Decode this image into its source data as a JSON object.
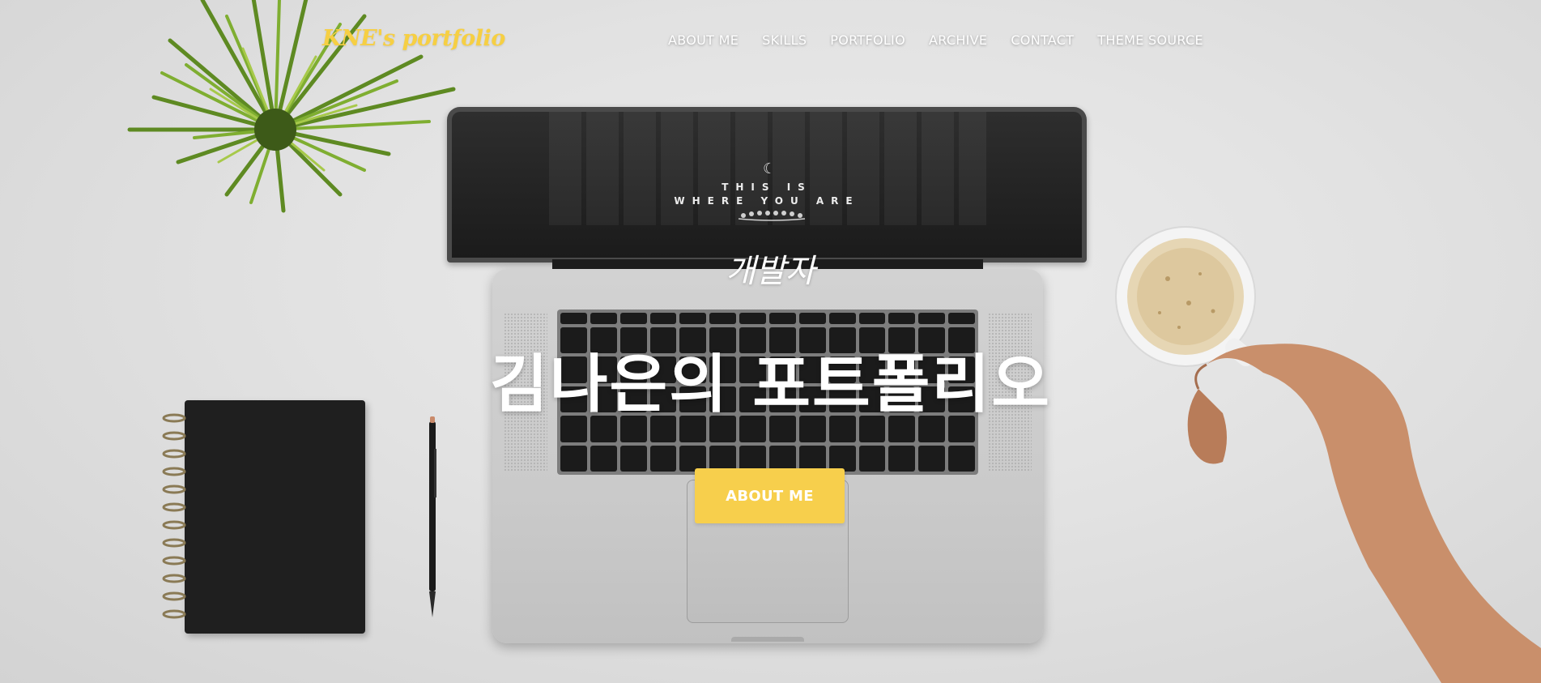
{
  "brand": {
    "name": "KNE's portfolio",
    "color": "#f6cf43"
  },
  "nav": {
    "items": [
      {
        "label": "ABOUT ME"
      },
      {
        "label": "SKILLS"
      },
      {
        "label": "PORTFOLIO"
      },
      {
        "label": "ARCHIVE"
      },
      {
        "label": "CONTACT"
      },
      {
        "label": "THEME SOURCE"
      }
    ]
  },
  "hero": {
    "subtitle": "개발자",
    "title": "김나은의 포트폴리오",
    "cta_label": "ABOUT ME",
    "cta_color": "#f7cf4c"
  },
  "laptop_screen": {
    "line1": "THIS IS",
    "line2": "WHERE YOU ARE"
  }
}
